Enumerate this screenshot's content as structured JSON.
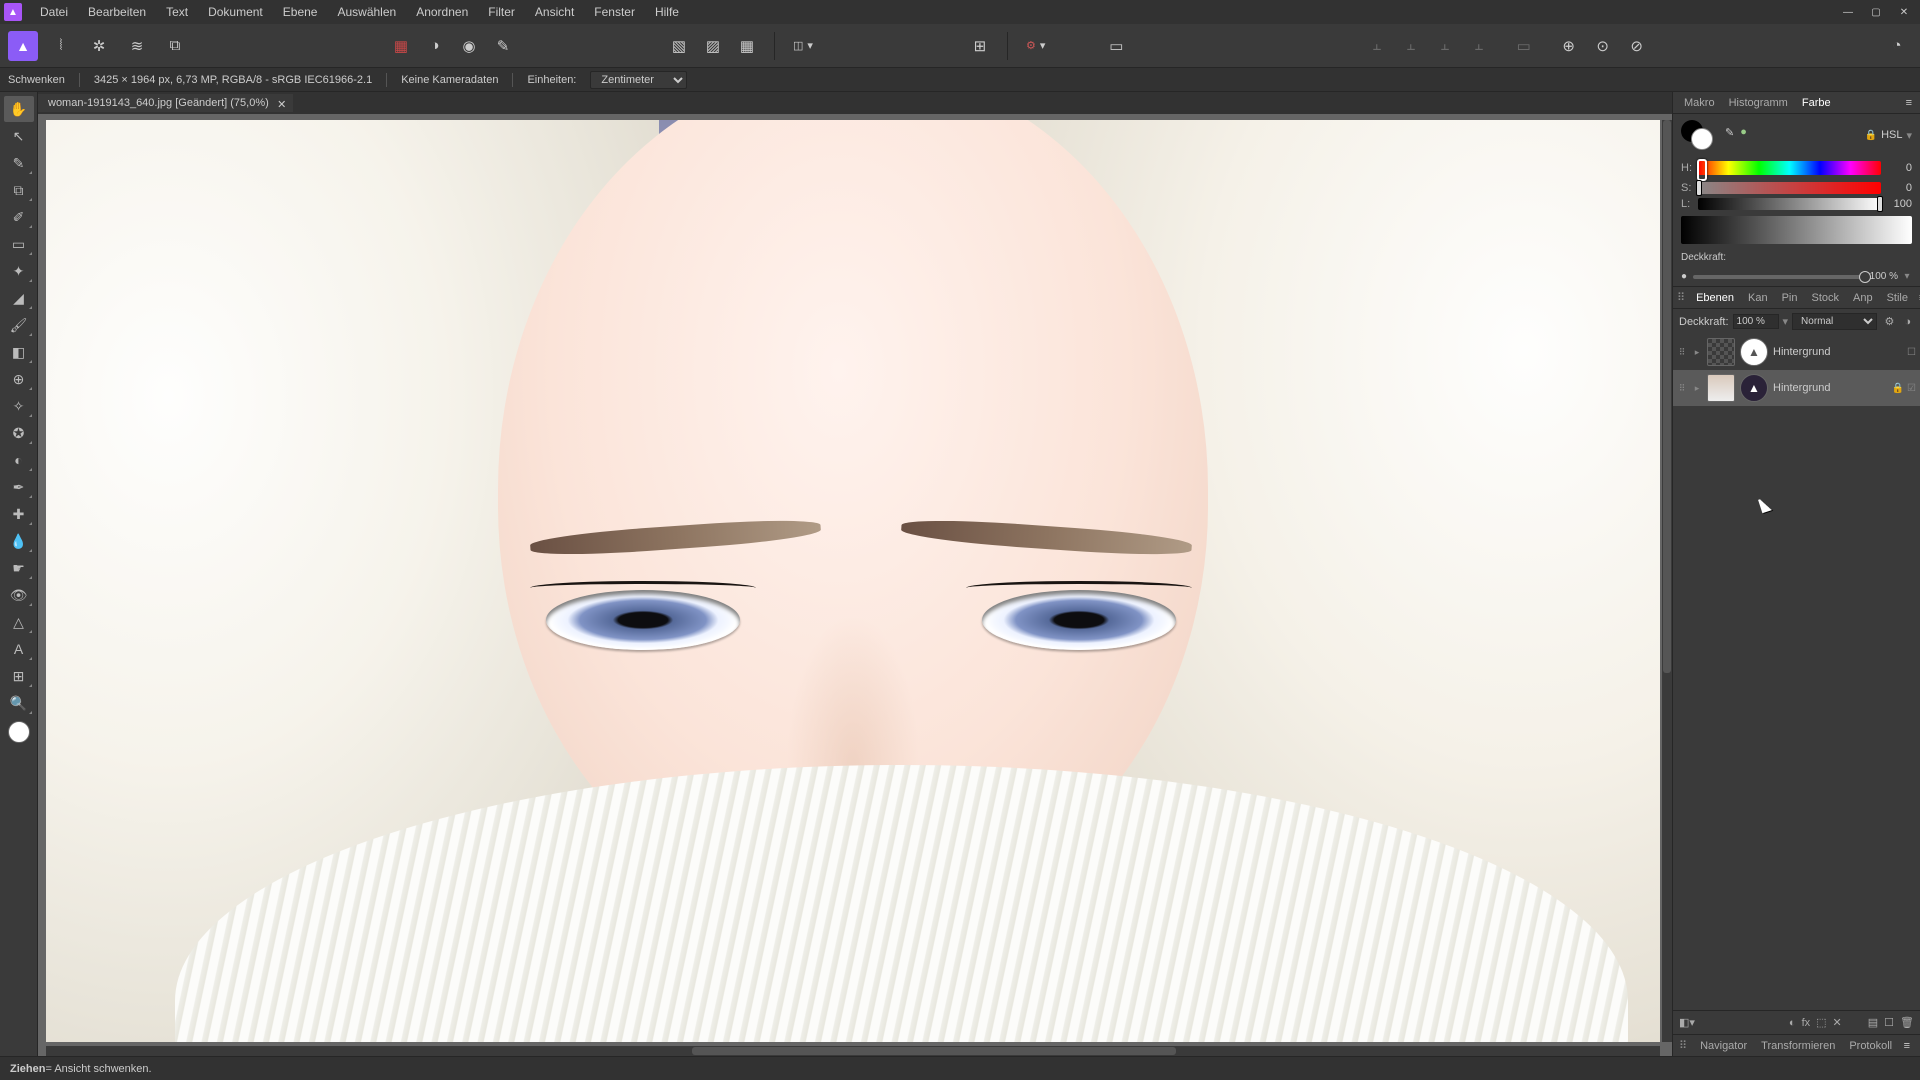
{
  "menu": [
    "Datei",
    "Bearbeiten",
    "Text",
    "Dokument",
    "Ebene",
    "Auswählen",
    "Anordnen",
    "Filter",
    "Ansicht",
    "Fenster",
    "Hilfe"
  ],
  "toolbar": {
    "snap_label": "◫"
  },
  "info": {
    "tool": "Schwenken",
    "dims": "3425 × 1964 px, 6,73 MP, RGBA/8 - sRGB IEC61966-2.1",
    "camera": "Keine Kameradaten",
    "units_label": "Einheiten:",
    "units_value": "Zentimeter"
  },
  "doc_tab": {
    "title": "woman-1919143_640.jpg [Geändert] (75,0%)"
  },
  "color_tabs": [
    "Makro",
    "Histogramm",
    "Farbe"
  ],
  "color": {
    "mode": "HSL",
    "h_label": "H:",
    "h_val": "0",
    "s_label": "S:",
    "s_val": "0",
    "l_label": "L:",
    "l_val": "100",
    "opacity_label": "Deckkraft:",
    "opacity_val": "100 %"
  },
  "layer_tabs": [
    "Ebenen",
    "Kan",
    "Pin",
    "Stock",
    "Anp",
    "Stile"
  ],
  "layers": {
    "deck_label": "Deckkraft:",
    "deck_val": "100 %",
    "blend": "Normal",
    "items": [
      {
        "name": "Hintergrund",
        "selected": false,
        "locked": false
      },
      {
        "name": "Hintergrund",
        "selected": true,
        "locked": true
      }
    ]
  },
  "bottom_tabs": [
    "Navigator",
    "Transformieren",
    "Protokoll"
  ],
  "status": {
    "bold": "Ziehen",
    "rest": " = Ansicht schwenken."
  }
}
